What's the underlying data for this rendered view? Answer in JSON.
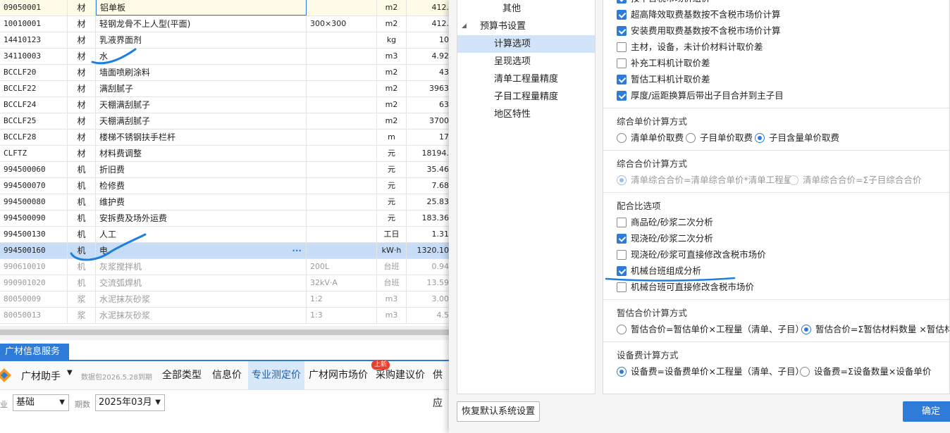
{
  "grid": {
    "rows": [
      {
        "code": "09050001",
        "type": "材",
        "name": "铝单板",
        "spec": "",
        "unit": "m2",
        "qty": "412."
      },
      {
        "code": "10010001",
        "type": "材",
        "name": "轻钢龙骨不上人型(平面)",
        "spec": "300×300",
        "unit": "m2",
        "qty": "412."
      },
      {
        "code": "14410123",
        "type": "材",
        "name": "乳液界面剂",
        "spec": "",
        "unit": "kg",
        "qty": "10"
      },
      {
        "code": "34110003",
        "type": "材",
        "name": "水",
        "spec": "",
        "unit": "m3",
        "qty": "4.92"
      },
      {
        "code": "BCCLF20",
        "type": "材",
        "name": "墙面喷刷涂料",
        "spec": "",
        "unit": "m2",
        "qty": "43"
      },
      {
        "code": "BCCLF22",
        "type": "材",
        "name": "满刮腻子",
        "spec": "",
        "unit": "m2",
        "qty": "3963"
      },
      {
        "code": "BCCLF24",
        "type": "材",
        "name": "天棚满刮腻子",
        "spec": "",
        "unit": "m2",
        "qty": "63"
      },
      {
        "code": "BCCLF25",
        "type": "材",
        "name": "天棚满刮腻子",
        "spec": "",
        "unit": "m2",
        "qty": "3700"
      },
      {
        "code": "BCCLF28",
        "type": "材",
        "name": "楼梯不锈钢扶手栏杆",
        "spec": "",
        "unit": "m",
        "qty": "17"
      },
      {
        "code": "CLFTZ",
        "type": "材",
        "name": "材料费调整",
        "spec": "",
        "unit": "元",
        "qty": "18194."
      },
      {
        "code": "994500060",
        "type": "机",
        "name": "折旧费",
        "spec": "",
        "unit": "元",
        "qty": "35.46"
      },
      {
        "code": "994500070",
        "type": "机",
        "name": "检修费",
        "spec": "",
        "unit": "元",
        "qty": "7.68"
      },
      {
        "code": "994500080",
        "type": "机",
        "name": "维护费",
        "spec": "",
        "unit": "元",
        "qty": "25.83"
      },
      {
        "code": "994500090",
        "type": "机",
        "name": "安拆费及场外运费",
        "spec": "",
        "unit": "元",
        "qty": "183.36"
      },
      {
        "code": "994500130",
        "type": "机",
        "name": "人工",
        "spec": "",
        "unit": "工日",
        "qty": "1.31"
      },
      {
        "code": "994500160",
        "type": "机",
        "name": "电",
        "spec": "",
        "unit": "kW·h",
        "qty": "1320.10"
      },
      {
        "code": "990610010",
        "type": "机",
        "name": "灰浆搅拌机",
        "spec": "200L",
        "unit": "台班",
        "qty": "0.94"
      },
      {
        "code": "990901020",
        "type": "机",
        "name": "交流弧焊机",
        "spec": "32kV·A",
        "unit": "台班",
        "qty": "13.59"
      },
      {
        "code": "80050009",
        "type": "浆",
        "name": "水泥抹灰砂浆",
        "spec": "1:2",
        "unit": "m3",
        "qty": "3.00"
      },
      {
        "code": "80050013",
        "type": "浆",
        "name": "水泥抹灰砂浆",
        "spec": "1:3",
        "unit": "m3",
        "qty": "4.5"
      }
    ],
    "selected_ellipsis": "···"
  },
  "info_panel": {
    "tab": "广材信息服务",
    "helper": "广材助手",
    "package": "数据包2026.5.28到期",
    "tabs": [
      "全部类型",
      "信息价",
      "专业测定价",
      "广材网市场价",
      "采购建议价",
      "供应"
    ],
    "badge": "上新",
    "filter_label_1": "业",
    "filter_value_1": "基础",
    "filter_label_2": "期数",
    "filter_value_2": "2025年03月"
  },
  "dialog": {
    "tree": {
      "other": "其他",
      "budget_settings": "预算书设置",
      "children": [
        "计算选项",
        "呈现选项",
        "清单工程量精度",
        "子目工程量精度",
        "地区特性"
      ]
    },
    "options": {
      "top_checks": [
        {
          "label": "按不含税市场价组价",
          "checked": true
        },
        {
          "label": "超高降效取费基数按不含税市场价计算",
          "checked": true
        },
        {
          "label": "安装费用取费基数按不含税市场价计算",
          "checked": true
        },
        {
          "label": "主材，设备，未计价材料计取价差",
          "checked": false
        },
        {
          "label": "补充工料机计取价差",
          "checked": false
        },
        {
          "label": "暂估工料机计取价差",
          "checked": true
        },
        {
          "label": "厚度/运距换算后带出子目合并到主子目",
          "checked": true
        }
      ],
      "unit_price_title": "综合单价计算方式",
      "unit_price_radios": [
        "清单单价取费",
        "子目单价取费",
        "子目含量单价取费"
      ],
      "total_price_title": "综合合价计算方式",
      "total_price_radios": [
        "清单综合合价=清单综合单价*清单工程量",
        "清单综合合价=Σ子目综合合价"
      ],
      "mix_title": "配合比选项",
      "mix_checks": [
        {
          "label": "商品砼/砂浆二次分析",
          "checked": false
        },
        {
          "label": "现浇砼/砂浆二次分析",
          "checked": true
        },
        {
          "label": "现浇砼/砂浆可直接修改含税市场价",
          "checked": false
        },
        {
          "label": "机械台班组成分析",
          "checked": true
        },
        {
          "label": "机械台班可直接修改含税市场价",
          "checked": false
        }
      ],
      "temp_title": "暂估合价计算方式",
      "temp_radios": [
        "暂估合价=暂估单价×工程量（清单、子目）",
        "暂估合价=Σ暂估材料数量 ×暂估材料"
      ],
      "equip_title": "设备费计算方式",
      "equip_radios": [
        "设备费=设备费单价×工程量（清单、子目）",
        "设备费=Σ设备数量×设备单价"
      ]
    },
    "reset_button": "恢复默认系统设置",
    "ok_button": "确定"
  }
}
